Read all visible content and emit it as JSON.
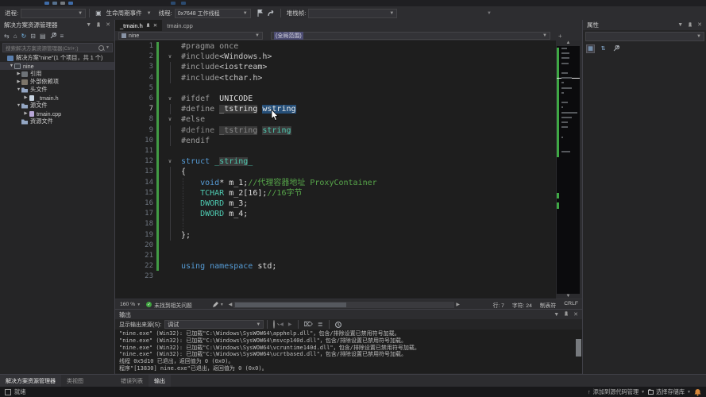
{
  "colors": {
    "editor_bg": "#1e1e1e",
    "chrome_bg": "#2d2d30",
    "panel_bg": "#252526",
    "keyword": "#569cd6",
    "type": "#4ec9b0",
    "comment": "#57a64a",
    "selection": "#264f78",
    "change_bar_green": "#429b45",
    "check_green": "#3fa33f"
  },
  "toolbar": {
    "process_label": "进程:",
    "lifecycle_label": "生命周期事件",
    "thread_label": "线程:",
    "thread_value": "0x7648 工作线程",
    "frame_label": "堆栈帧:"
  },
  "solution_explorer": {
    "title": "解决方案资源管理器",
    "search_placeholder": "搜索解决方案资源管理器(Ctrl+;)",
    "tree": [
      {
        "indent": 0,
        "arrow": "",
        "icon": "solution",
        "label": "解决方案\"nine\"(1 个项目，共 1 个)"
      },
      {
        "indent": 1,
        "arrow": "open",
        "icon": "project",
        "label": "nine",
        "selected": true
      },
      {
        "indent": 2,
        "arrow": "closed",
        "icon": "refs",
        "label": "引用"
      },
      {
        "indent": 2,
        "arrow": "closed",
        "icon": "deps",
        "label": "外部依赖项"
      },
      {
        "indent": 2,
        "arrow": "open",
        "icon": "folder",
        "label": "头文件"
      },
      {
        "indent": 3,
        "arrow": "closed",
        "icon": "hfile",
        "label": "_tmain.h"
      },
      {
        "indent": 2,
        "arrow": "open",
        "icon": "folder",
        "label": "源文件"
      },
      {
        "indent": 3,
        "arrow": "closed",
        "icon": "cppfile",
        "label": "tmain.cpp"
      },
      {
        "indent": 2,
        "arrow": "",
        "icon": "folder",
        "label": "资源文件"
      }
    ]
  },
  "editor": {
    "tabs": [
      {
        "label": "_tmain.h",
        "active": true
      },
      {
        "label": "tmain.cpp",
        "active": false
      }
    ],
    "navbar_project": "nine",
    "navbar_scope": "(全局范围)",
    "code_lines": [
      {
        "n": 1,
        "tokens": [
          [
            "pp",
            "#pragma once"
          ]
        ]
      },
      {
        "n": 2,
        "fold": true,
        "tokens": [
          [
            "pp",
            "#include"
          ],
          [
            "inc",
            "<Windows.h>"
          ]
        ]
      },
      {
        "n": 3,
        "g1": true,
        "tokens": [
          [
            "pp",
            "#include"
          ],
          [
            "inc",
            "<iostream>"
          ]
        ]
      },
      {
        "n": 4,
        "g1": true,
        "tokens": [
          [
            "pp",
            "#include"
          ],
          [
            "inc",
            "<tchar.h>"
          ]
        ]
      },
      {
        "n": 5,
        "tokens": []
      },
      {
        "n": 6,
        "fold": true,
        "tokens": [
          [
            "pp",
            "#ifdef  "
          ],
          [
            "pl",
            "UNICODE"
          ]
        ]
      },
      {
        "n": 7,
        "g1": true,
        "tokens": [
          [
            "pp",
            "#define "
          ],
          [
            "pl hl",
            "_tstring"
          ],
          [
            "pl",
            " "
          ],
          [
            "pl sel",
            "wstring"
          ]
        ]
      },
      {
        "n": 8,
        "fold": true,
        "tokens": [
          [
            "pp",
            "#else"
          ]
        ]
      },
      {
        "n": 9,
        "g1": true,
        "tokens": [
          [
            "pp2",
            "#define "
          ],
          [
            "pp2 hl",
            "_tstring"
          ],
          [
            "pp2",
            " "
          ],
          [
            "ty hl",
            "string"
          ]
        ]
      },
      {
        "n": 10,
        "g1": true,
        "tokens": [
          [
            "pp",
            "#endif"
          ]
        ]
      },
      {
        "n": 11,
        "tokens": []
      },
      {
        "n": 12,
        "fold": true,
        "tokens": [
          [
            "kw",
            "struct"
          ],
          [
            "ty",
            " _"
          ],
          [
            "ty hl",
            "string"
          ],
          [
            "ty",
            "_"
          ]
        ]
      },
      {
        "n": 13,
        "g1": true,
        "tokens": [
          [
            "pl",
            "{"
          ]
        ]
      },
      {
        "n": 14,
        "g1": true,
        "g2": true,
        "tokens": [
          [
            "pl",
            "    "
          ],
          [
            "kw",
            "void"
          ],
          [
            "pl",
            "* m_1;"
          ],
          [
            "cm",
            "//代理容器地址 ProxyContainer"
          ]
        ]
      },
      {
        "n": 15,
        "g1": true,
        "g2": true,
        "tokens": [
          [
            "pl",
            "    "
          ],
          [
            "ty",
            "TCHAR"
          ],
          [
            "pl",
            " m_2[16];"
          ],
          [
            "cm",
            "//16字节"
          ]
        ]
      },
      {
        "n": 16,
        "g1": true,
        "g2": true,
        "tokens": [
          [
            "pl",
            "    "
          ],
          [
            "ty",
            "DWORD"
          ],
          [
            "pl",
            " m_3;"
          ]
        ]
      },
      {
        "n": 17,
        "g1": true,
        "g2": true,
        "tokens": [
          [
            "pl",
            "    "
          ],
          [
            "ty",
            "DWORD"
          ],
          [
            "pl",
            " m_4;"
          ]
        ]
      },
      {
        "n": 18,
        "g1": true,
        "g2": true,
        "tokens": []
      },
      {
        "n": 19,
        "g1": true,
        "tokens": [
          [
            "pl",
            "};"
          ]
        ]
      },
      {
        "n": 20,
        "tokens": []
      },
      {
        "n": 21,
        "tokens": []
      },
      {
        "n": 22,
        "tokens": [
          [
            "kw",
            "using"
          ],
          [
            "pl",
            " "
          ],
          [
            "kw",
            "namespace"
          ],
          [
            "pl",
            " std;"
          ]
        ]
      },
      {
        "n": 23,
        "tokens": []
      }
    ],
    "current_line": 7,
    "status": {
      "zoom": "160 %",
      "health": "未找到相关问题",
      "line": "行: 7",
      "col": "字符: 24",
      "tabs": "制表符",
      "eol": "CRLF"
    }
  },
  "output": {
    "title": "输出",
    "source_label": "显示输出来源(S):",
    "source_value": "调试",
    "lines": [
      "\"nine.exe\" (Win32): 已加载\"C:\\Windows\\SysWOW64\\apphelp.dll\"，包含/排除设置已禁用符号加载。",
      "\"nine.exe\" (Win32): 已加载\"C:\\Windows\\SysWOW64\\msvcp140d.dll\"，包含/排除设置已禁用符号加载。",
      "\"nine.exe\" (Win32): 已加载\"C:\\Windows\\SysWOW64\\vcruntime140d.dll\"，包含/排除设置已禁用符号加载。",
      "\"nine.exe\" (Win32): 已加载\"C:\\Windows\\SysWOW64\\ucrtbased.dll\"，包含/排除设置已禁用符号加载。",
      "线程 0x5d10 已退出，返回值为 0 (0x0)。",
      "程序\"[13830] nine.exe\"已退出，返回值为 0 (0x0)。"
    ]
  },
  "bottom_tabs_left": [
    {
      "label": "解决方案资源管理器",
      "active": true
    },
    {
      "label": "类视图",
      "active": false
    }
  ],
  "bottom_tabs_center": [
    {
      "label": "错误列表",
      "active": false
    },
    {
      "label": "输出",
      "active": true
    }
  ],
  "properties": {
    "title": "属性"
  },
  "statusbar": {
    "ready": "就绪",
    "add_source_control": "添加到源代码管理",
    "select_repo": "选择存储库"
  }
}
